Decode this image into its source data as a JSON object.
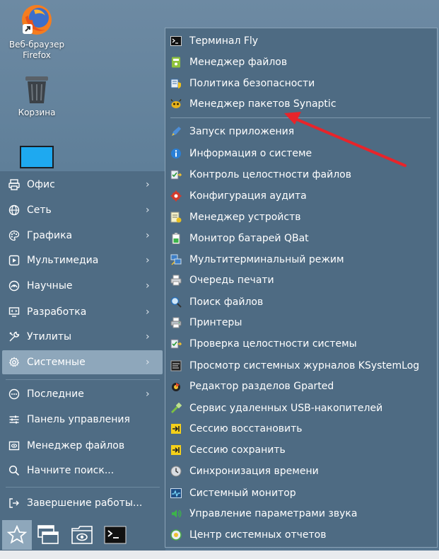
{
  "desktop": {
    "icons": [
      {
        "label": "Веб-браузер Firefox",
        "icon": "firefox-icon"
      },
      {
        "label": "Корзина",
        "icon": "trash-icon"
      },
      {
        "label": "",
        "icon": "monitor-icon"
      }
    ]
  },
  "menu": {
    "items": [
      {
        "label": "Офис",
        "icon": "office-icon"
      },
      {
        "label": "Сеть",
        "icon": "globe-icon"
      },
      {
        "label": "Графика",
        "icon": "palette-icon"
      },
      {
        "label": "Мультимедиа",
        "icon": "play-icon"
      },
      {
        "label": "Научные",
        "icon": "science-icon"
      },
      {
        "label": "Разработка",
        "icon": "code-icon"
      },
      {
        "label": "Утилиты",
        "icon": "tools-icon"
      },
      {
        "label": "Системные",
        "icon": "gear-icon"
      }
    ],
    "bottom": [
      {
        "label": "Последние",
        "icon": "recent-icon"
      },
      {
        "label": "Панель управления",
        "icon": "sliders-icon"
      },
      {
        "label": "Менеджер файлов",
        "icon": "file-manager-icon"
      },
      {
        "label": "Начните поиск...",
        "icon": "search-icon"
      },
      {
        "label": "Завершение работы...",
        "icon": "logout-icon"
      }
    ],
    "active_index": 7
  },
  "submenu": {
    "items": [
      {
        "label": "Терминал Fly",
        "icon": "terminal-icon"
      },
      {
        "label": "Менеджер файлов",
        "icon": "file-manager-icon"
      },
      {
        "label": "Политика безопасности",
        "icon": "security-policy-icon"
      },
      {
        "label": "Менеджер пакетов Synaptic",
        "icon": "synaptic-icon"
      },
      {
        "label": "Запуск приложения",
        "icon": "launch-icon"
      },
      {
        "label": "Информация о системе",
        "icon": "info-icon"
      },
      {
        "label": "Контроль целостности файлов",
        "icon": "integrity-icon"
      },
      {
        "label": "Конфигурация аудита",
        "icon": "audit-icon"
      },
      {
        "label": "Менеджер устройств",
        "icon": "devices-icon"
      },
      {
        "label": "Монитор батарей QBat",
        "icon": "battery-icon"
      },
      {
        "label": "Мультитерминальный режим",
        "icon": "multiterminal-icon"
      },
      {
        "label": "Очередь печати",
        "icon": "print-queue-icon"
      },
      {
        "label": "Поиск файлов",
        "icon": "search-files-icon"
      },
      {
        "label": "Принтеры",
        "icon": "printer-icon"
      },
      {
        "label": "Проверка целостности системы",
        "icon": "system-check-icon"
      },
      {
        "label": "Просмотр системных журналов KSystemLog",
        "icon": "log-icon"
      },
      {
        "label": "Редактор разделов Gparted",
        "icon": "gparted-icon"
      },
      {
        "label": "Сервис удаленных USB-накопителей",
        "icon": "usb-icon"
      },
      {
        "label": "Сессию восстановить",
        "icon": "session-restore-icon"
      },
      {
        "label": "Сессию сохранить",
        "icon": "session-save-icon"
      },
      {
        "label": "Синхронизация времени",
        "icon": "time-sync-icon"
      },
      {
        "label": "Системный монитор",
        "icon": "system-monitor-icon"
      },
      {
        "label": "Управление параметрами звука",
        "icon": "sound-icon"
      },
      {
        "label": "Центр системных отчетов",
        "icon": "reports-icon"
      }
    ]
  },
  "taskbar": {
    "buttons": [
      "start-icon",
      "windows-icon",
      "file-manager-icon",
      "terminal-icon"
    ]
  },
  "colors": {
    "accent": "#8ea7bb",
    "arrow": "#e8242a"
  }
}
